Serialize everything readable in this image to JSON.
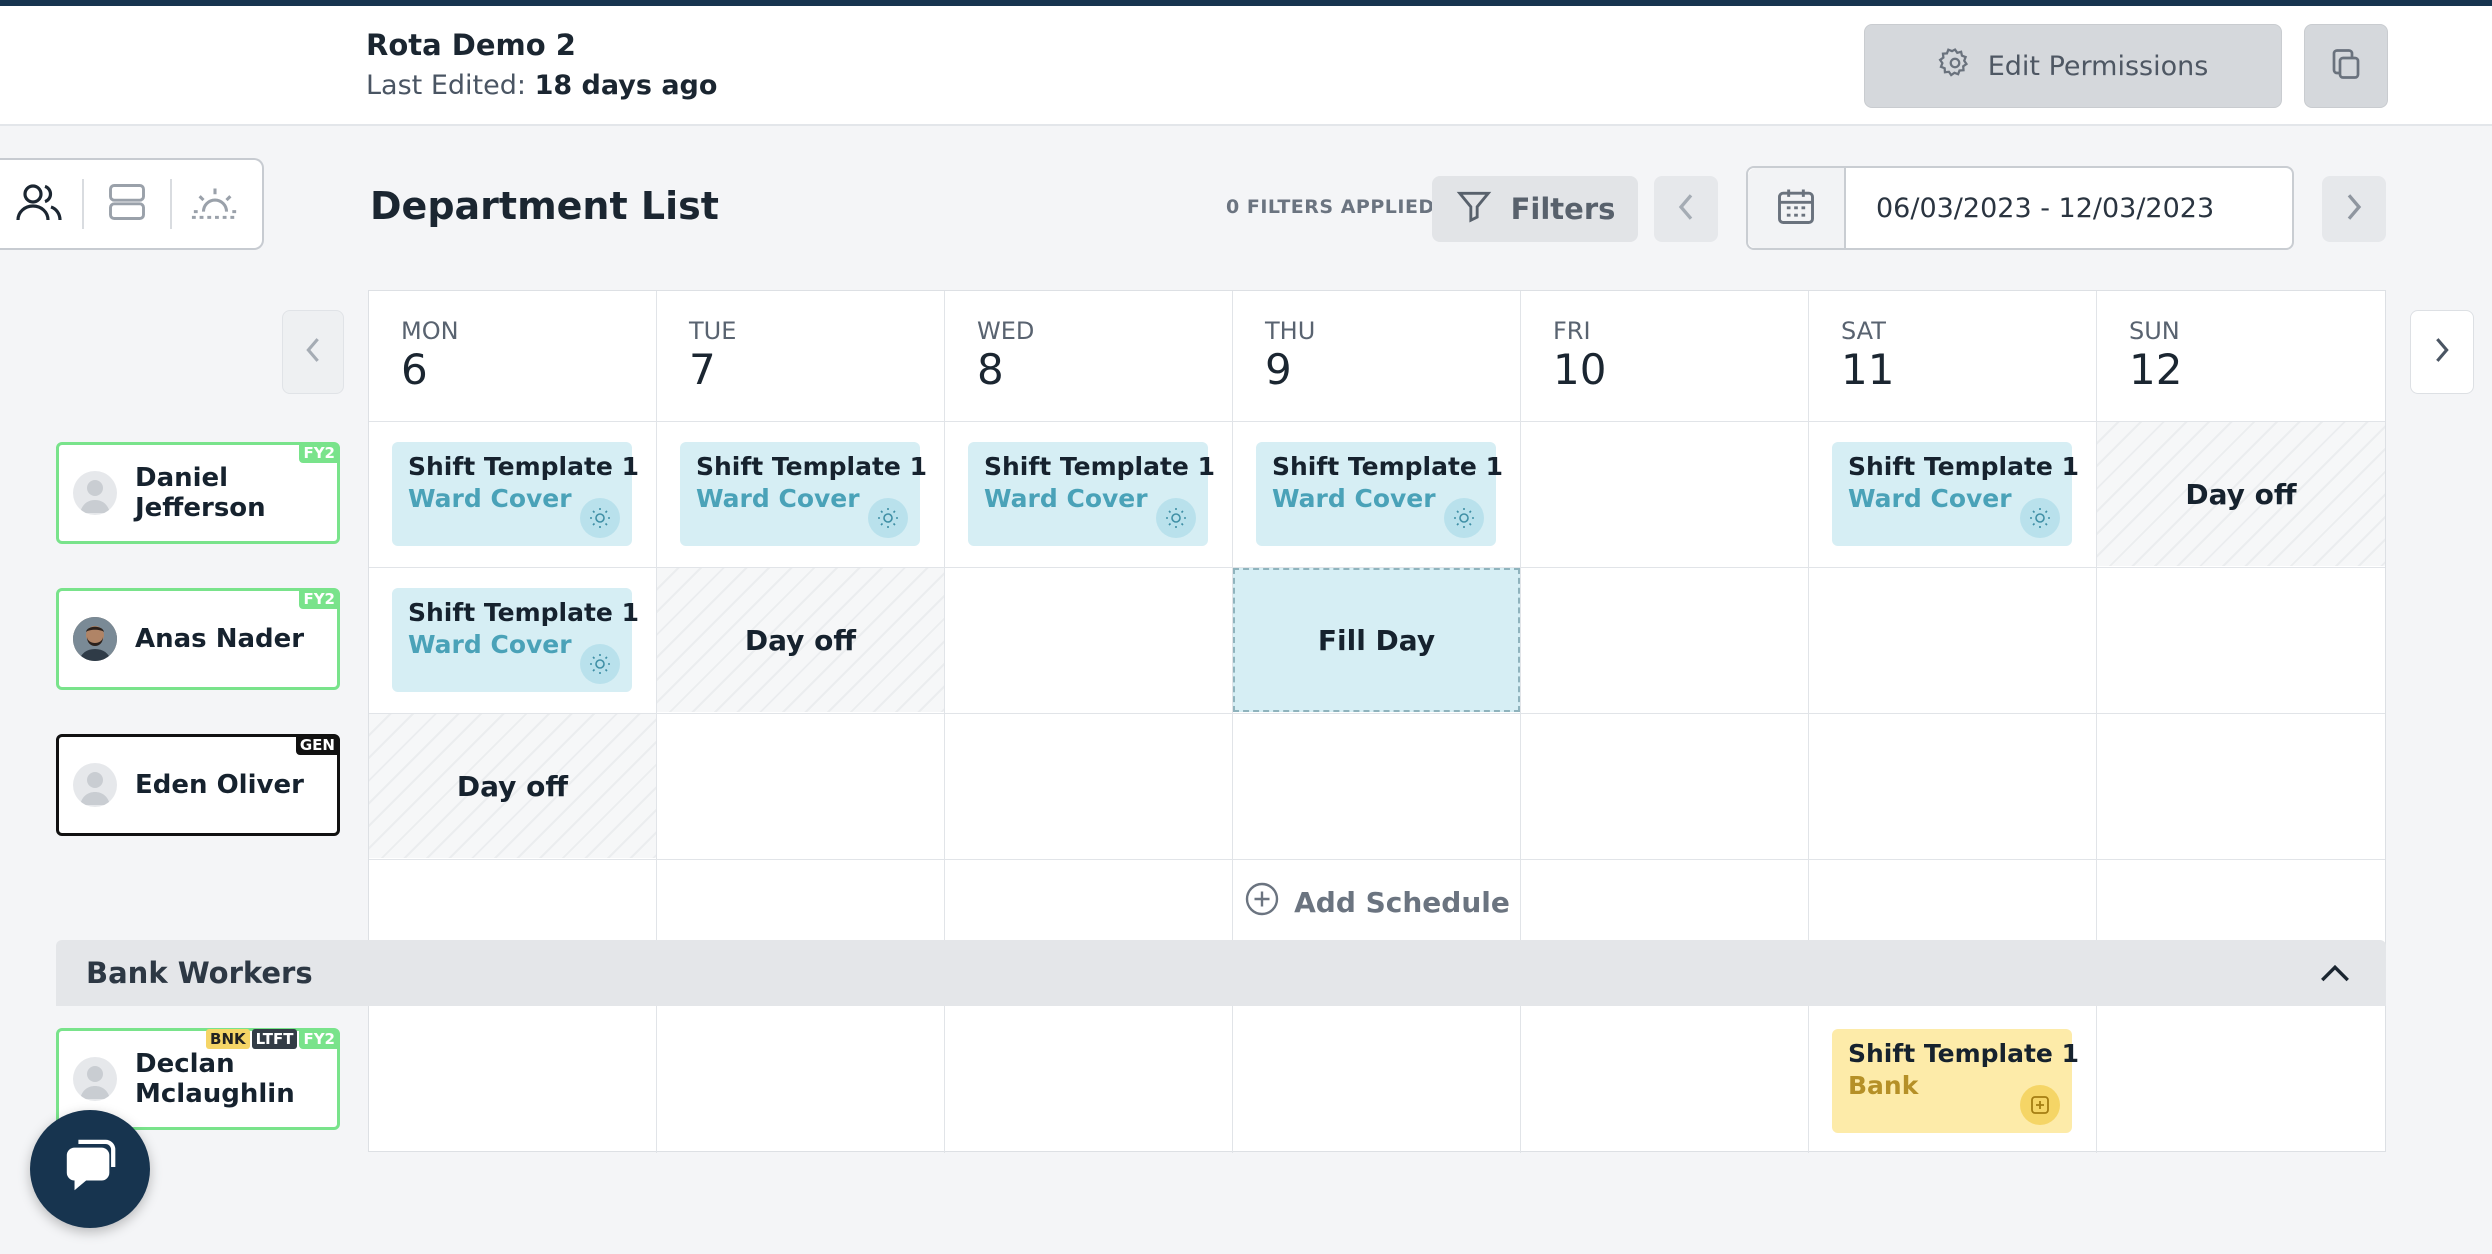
{
  "header": {
    "title": "Rota Demo 2",
    "last_edited_label": "Last Edited:",
    "last_edited_value": "18 days ago",
    "edit_permissions_label": "Edit Permissions"
  },
  "toolbar": {
    "section_title": "Department List",
    "filters_applied": "0 FILTERS APPLIED",
    "filters_label": "Filters",
    "date_range": "06/03/2023 - 12/03/2023"
  },
  "days": [
    {
      "name": "MON",
      "num": "6"
    },
    {
      "name": "TUE",
      "num": "7"
    },
    {
      "name": "WED",
      "num": "8"
    },
    {
      "name": "THU",
      "num": "9"
    },
    {
      "name": "FRI",
      "num": "10"
    },
    {
      "name": "SAT",
      "num": "11"
    },
    {
      "name": "SUN",
      "num": "12"
    }
  ],
  "workers": [
    {
      "name": "Daniel Jefferson",
      "badge": "FY2"
    },
    {
      "name": "Anas Nader",
      "badge": "FY2"
    },
    {
      "name": "Eden Oliver",
      "badge": "GEN"
    }
  ],
  "bank_section": {
    "title": "Bank Workers",
    "worker_name_line1": "Declan",
    "worker_name_line2": "Mclaughlin",
    "badges": [
      "BNK",
      "LTFT",
      "FY2"
    ]
  },
  "cells": {
    "shift_title": "Shift Template 1",
    "ward_cover": "Ward Cover",
    "bank": "Bank",
    "day_off": "Day off",
    "fill_day": "Fill Day"
  },
  "add_schedule_label": "Add Schedule",
  "colors": {
    "accent_dark": "#17344f",
    "shift_bg": "#d6eef4",
    "shift_sub": "#4aa2b8",
    "bank_bg": "#fdeba9",
    "fy2_green": "#79e38b"
  }
}
